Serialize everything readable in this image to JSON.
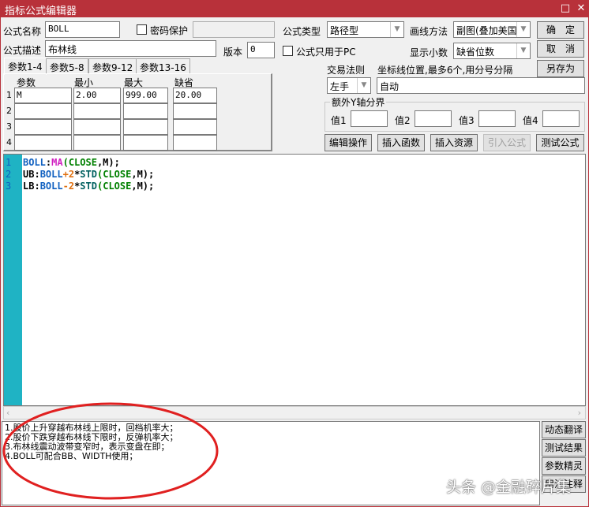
{
  "window": {
    "title": "指标公式编辑器",
    "minimize_icon": "□",
    "close_icon": "✕"
  },
  "form": {
    "name_label": "公式名称",
    "name_value": "BOLL",
    "password_label": "密码保护",
    "desc_label": "公式描述",
    "desc_value": "布林线",
    "version_label": "版本",
    "version_value": "0",
    "type_label": "公式类型",
    "type_value": "路径型",
    "draw_label": "画线方法",
    "draw_value": "副图(叠加美国",
    "pc_only_label": "公式只用于PC",
    "decimal_label": "显示小数",
    "decimal_value": "缺省位数",
    "trade_rule_label": "交易法则",
    "trade_rule_value": "左手",
    "axis_label": "坐标线位置,最多6个,用分号分隔",
    "axis_value": "自动",
    "yaxis_group": "额外Y轴分界",
    "yaxis": [
      {
        "label": "值1",
        "value": ""
      },
      {
        "label": "值2",
        "value": ""
      },
      {
        "label": "值3",
        "value": ""
      },
      {
        "label": "值4",
        "value": ""
      }
    ]
  },
  "buttons": {
    "ok": "确　定",
    "cancel": "取　消",
    "save_as": "另存为",
    "edit_ops": "编辑操作",
    "insert_func": "插入函数",
    "insert_res": "插入资源",
    "import_formula": "引入公式",
    "test_formula": "测试公式",
    "translate": "动态翻译",
    "test_result": "测试结果",
    "param_wizard": "参数精灵",
    "usage_notes": "用法注释"
  },
  "tabs": [
    "参数1-4",
    "参数5-8",
    "参数9-12",
    "参数13-16"
  ],
  "params": {
    "headers": [
      "参数",
      "最小",
      "最大",
      "缺省"
    ],
    "rows": [
      {
        "n": "1",
        "name": "M",
        "min": "2.00",
        "max": "999.00",
        "def": "20.00"
      },
      {
        "n": "2",
        "name": "",
        "min": "",
        "max": "",
        "def": ""
      },
      {
        "n": "3",
        "name": "",
        "min": "",
        "max": "",
        "def": ""
      },
      {
        "n": "4",
        "name": "",
        "min": "",
        "max": "",
        "def": ""
      }
    ]
  },
  "code": {
    "line_numbers": [
      "1",
      "2",
      "3"
    ],
    "lines": [
      [
        {
          "t": "BOLL",
          "c": "#1060c0"
        },
        {
          "t": ":",
          "c": "#000"
        },
        {
          "t": "MA",
          "c": "#d020c0"
        },
        {
          "t": "(",
          "c": "#008000"
        },
        {
          "t": "CLOSE",
          "c": "#008000"
        },
        {
          "t": ",M);",
          "c": "#000"
        }
      ],
      [
        {
          "t": "UB",
          "c": "#000"
        },
        {
          "t": ":",
          "c": "#000"
        },
        {
          "t": "BOLL",
          "c": "#1060c0"
        },
        {
          "t": "+",
          "c": "#e07010"
        },
        {
          "t": "2",
          "c": "#e07010"
        },
        {
          "t": "*",
          "c": "#000"
        },
        {
          "t": "STD",
          "c": "#006060"
        },
        {
          "t": "(",
          "c": "#008000"
        },
        {
          "t": "CLOSE",
          "c": "#008000"
        },
        {
          "t": ",M);",
          "c": "#000"
        }
      ],
      [
        {
          "t": "LB",
          "c": "#000"
        },
        {
          "t": ":",
          "c": "#000"
        },
        {
          "t": "BOLL",
          "c": "#1060c0"
        },
        {
          "t": "-",
          "c": "#e07010"
        },
        {
          "t": "2",
          "c": "#e07010"
        },
        {
          "t": "*",
          "c": "#000"
        },
        {
          "t": "STD",
          "c": "#006060"
        },
        {
          "t": "(",
          "c": "#008000"
        },
        {
          "t": "CLOSE",
          "c": "#008000"
        },
        {
          "t": ",M);",
          "c": "#000"
        }
      ]
    ]
  },
  "notes": [
    "1.股价上升穿越布林线上限时，回档机率大；",
    "2.股价下跌穿越布林线下限时，反弹机率大；",
    "3.布林线震动波带变窄时，表示变盘在即；",
    "4.BOLL可配合BB、WIDTH使用；"
  ],
  "watermark": "头条 @金融碎片集",
  "colors": {
    "title": "#b8313a",
    "gutter": "#1fb3c4",
    "annotation": "#e02020"
  }
}
